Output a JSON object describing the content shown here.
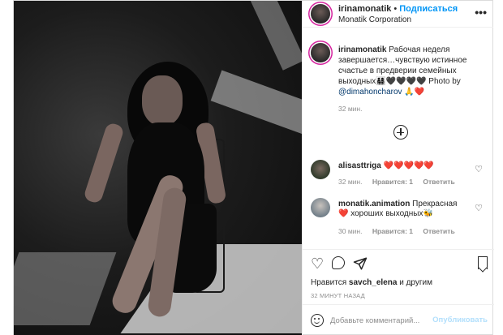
{
  "post": {
    "author": {
      "username": "irinamonatik",
      "location": "Monatik Corporation",
      "follow_label": "Подписаться",
      "separator": "•",
      "more_icon": "more-horizontal-icon"
    },
    "caption": {
      "username": "irinamonatik",
      "text": "Рабочая неделя завершается…чувствую истинное счастье в предверии семейных выходных👨‍👩‍👧‍👦🖤🖤🖤🖤 Photo by",
      "mention": "@dimahoncharov",
      "suffix": "🙏❤️",
      "time": "32 мин."
    },
    "load_more_icon": "plus-circle-icon",
    "comments": [
      {
        "username": "alisasttriga",
        "text": "❤️❤️❤️❤️❤️",
        "time": "32 мин.",
        "likes": "Нравится: 1",
        "reply": "Ответить"
      },
      {
        "username": "monatik.animation",
        "text": "Прекрасная ❤️ хороших выходных🐝",
        "time": "30 мин.",
        "likes": "Нравится: 1",
        "reply": "Ответить"
      }
    ],
    "actions": {
      "like_icon": "heart-icon",
      "comment_icon": "comment-icon",
      "share_icon": "send-icon",
      "save_icon": "bookmark-icon"
    },
    "likes": {
      "prefix": "Нравится",
      "user": "savch_elena",
      "suffix": "и другим"
    },
    "posted": "32 минут назад",
    "add_comment": {
      "placeholder": "Добавьте комментарий...",
      "publish_label": "Опубликовать"
    }
  },
  "colors": {
    "accent": "#0095f6",
    "publish_disabled": "#b2dffc",
    "muted": "#8e8e8e",
    "border": "#dbdbdb"
  }
}
